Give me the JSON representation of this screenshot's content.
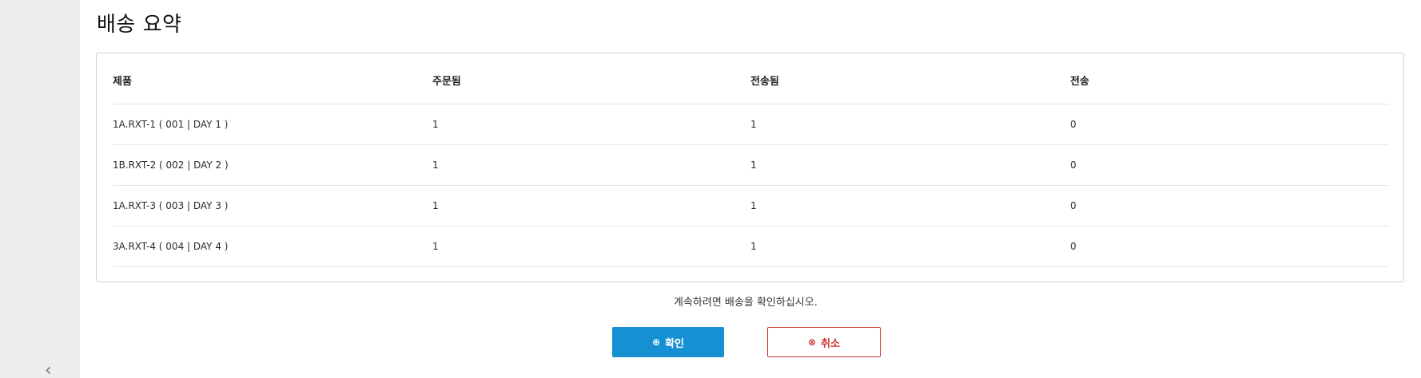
{
  "sidebar": {
    "collapse_glyph": "‹"
  },
  "page": {
    "title": "배송 요약"
  },
  "table": {
    "headers": [
      "제품",
      "주문됨",
      "전송됨",
      "전송"
    ],
    "rows": [
      [
        "1A.RXT-1 ( 001 | DAY 1 )",
        "1",
        "1",
        "0"
      ],
      [
        "1B.RXT-2 ( 002 | DAY 2 )",
        "1",
        "1",
        "0"
      ],
      [
        "1A.RXT-3 ( 003 | DAY 3 )",
        "1",
        "1",
        "0"
      ],
      [
        "3A.RXT-4 ( 004 | DAY 4 )",
        "1",
        "1",
        "0"
      ]
    ]
  },
  "footer": {
    "note": "계속하려면 배송을 확인하십시오.",
    "confirm_label": "확인",
    "confirm_icon": "⊕",
    "cancel_label": "취소",
    "cancel_icon": "⊗"
  },
  "colors": {
    "accent": "#1590d3",
    "danger": "#d0312d",
    "rail": "#eeeeee"
  }
}
